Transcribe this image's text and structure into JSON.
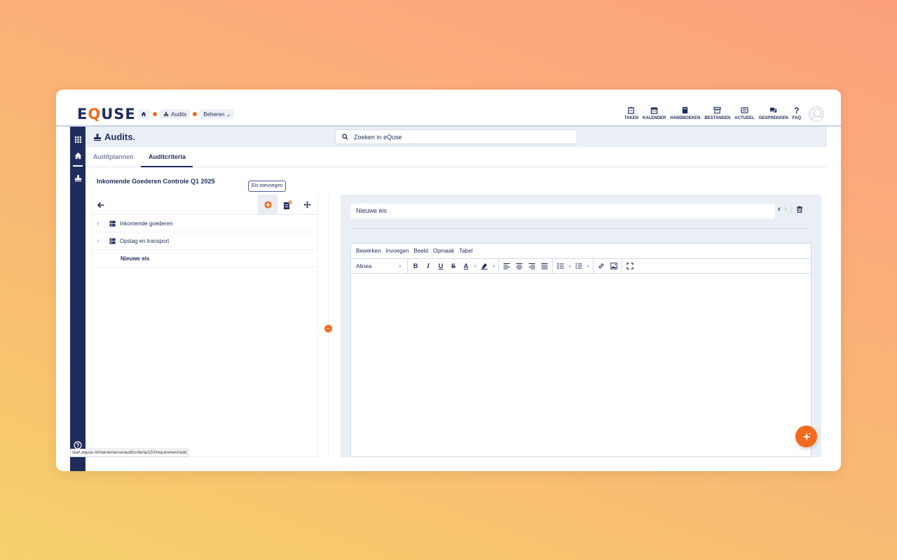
{
  "brand": {
    "logo_pre": "E",
    "logo_q": "Q",
    "logo_post": "USE"
  },
  "breadcrumbs": [
    {
      "icon": "home-icon",
      "label": ""
    },
    {
      "icon": "stamp-icon",
      "label": "Audits"
    },
    {
      "icon": "",
      "label": "Beheren ⌄"
    }
  ],
  "topnav": [
    {
      "icon": "clipboard-icon",
      "label": "TAKEN"
    },
    {
      "icon": "calendar-icon",
      "label": "KALENDER"
    },
    {
      "icon": "book-icon",
      "label": "HANDBOEKEN"
    },
    {
      "icon": "archive-icon",
      "label": "BESTANDEN"
    },
    {
      "icon": "newspaper-icon",
      "label": "ACTUEEL"
    },
    {
      "icon": "chat-icon",
      "label": "GESPREKKEN"
    },
    {
      "icon": "question-icon",
      "label": "FAQ"
    }
  ],
  "module": {
    "title": "Audits",
    "title_dot": "."
  },
  "search": {
    "placeholder": "Zoeken in eQuse"
  },
  "tabs": [
    {
      "label": "Auditplannen",
      "active": false
    },
    {
      "label": "Auditcriteria",
      "active": true
    }
  ],
  "page": {
    "title": "Inkomende Goederen Controle Q1 2025"
  },
  "tooltip": "Eis toevoegen",
  "tree": {
    "rows": [
      {
        "label": "Inkomende goederen",
        "type": "group"
      },
      {
        "label": "Opslag en transport",
        "type": "group"
      },
      {
        "label": "Nieuwe eis",
        "type": "leaf"
      }
    ]
  },
  "editor": {
    "title_value": "Nieuwe eis",
    "menus": [
      "Bewerken",
      "Invoegen",
      "Beeld",
      "Opmaak",
      "Tabel"
    ],
    "block_format": "Alinea"
  },
  "status_url": "start.equse.nl/maintenance/audit/criteria/150/requirement/add",
  "colors": {
    "accent": "#f26b1d",
    "navy": "#1f2d5c"
  }
}
